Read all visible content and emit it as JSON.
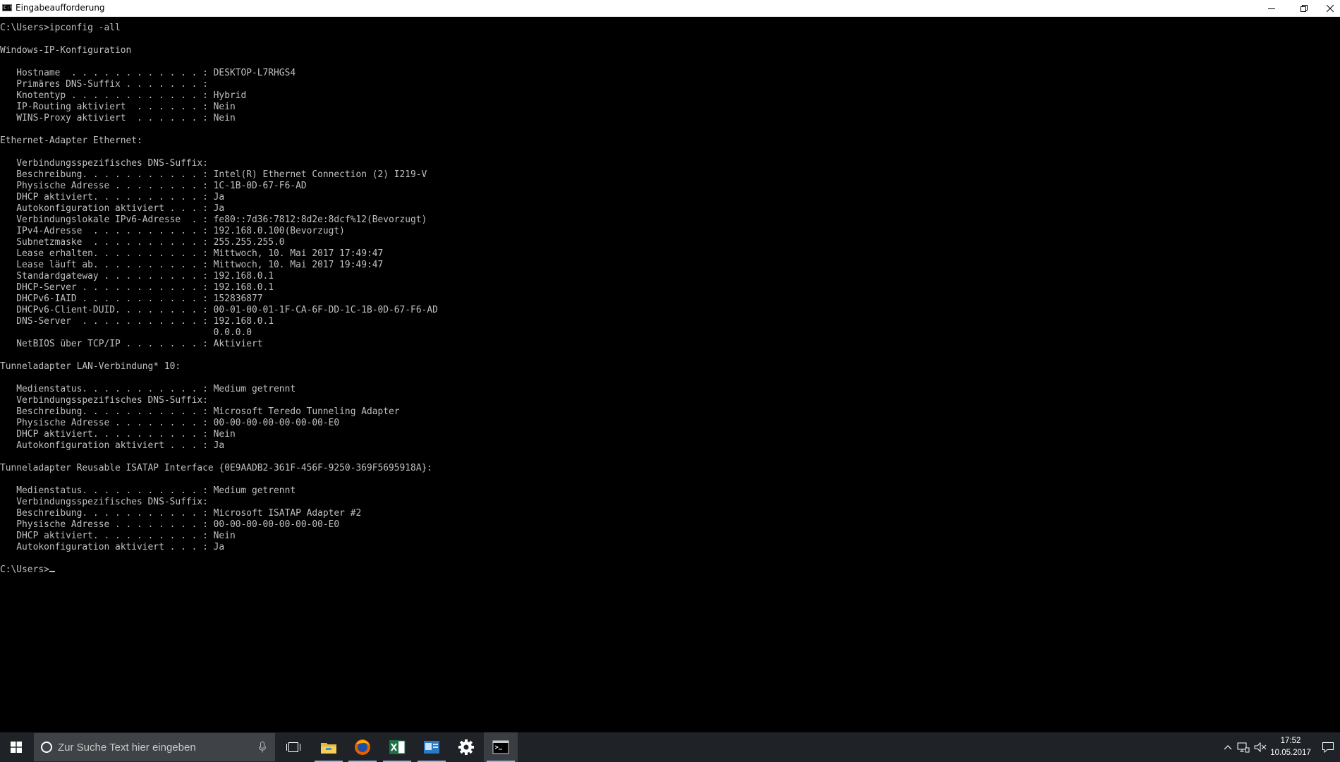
{
  "window": {
    "title": "Eingabeaufforderung",
    "icon_text": "C:\\",
    "controls": [
      "minimize-icon",
      "restore-icon",
      "close-icon"
    ]
  },
  "console": {
    "lines": [
      "C:\\Users>ipconfig -all",
      "",
      "Windows-IP-Konfiguration",
      "",
      "   Hostname  . . . . . . . . . . . . : DESKTOP-L7RHGS4",
      "   Primäres DNS-Suffix . . . . . . . :",
      "   Knotentyp . . . . . . . . . . . . : Hybrid",
      "   IP-Routing aktiviert  . . . . . . : Nein",
      "   WINS-Proxy aktiviert  . . . . . . : Nein",
      "",
      "Ethernet-Adapter Ethernet:",
      "",
      "   Verbindungsspezifisches DNS-Suffix:",
      "   Beschreibung. . . . . . . . . . . : Intel(R) Ethernet Connection (2) I219-V",
      "   Physische Adresse . . . . . . . . : 1C-1B-0D-67-F6-AD",
      "   DHCP aktiviert. . . . . . . . . . : Ja",
      "   Autokonfiguration aktiviert . . . : Ja",
      "   Verbindungslokale IPv6-Adresse  . : fe80::7d36:7812:8d2e:8dcf%12(Bevorzugt)",
      "   IPv4-Adresse  . . . . . . . . . . : 192.168.0.100(Bevorzugt)",
      "   Subnetzmaske  . . . . . . . . . . : 255.255.255.0",
      "   Lease erhalten. . . . . . . . . . : Mittwoch, 10. Mai 2017 17:49:47",
      "   Lease läuft ab. . . . . . . . . . : Mittwoch, 10. Mai 2017 19:49:47",
      "   Standardgateway . . . . . . . . . : 192.168.0.1",
      "   DHCP-Server . . . . . . . . . . . : 192.168.0.1",
      "   DHCPv6-IAID . . . . . . . . . . . : 152836877",
      "   DHCPv6-Client-DUID. . . . . . . . : 00-01-00-01-1F-CA-6F-DD-1C-1B-0D-67-F6-AD",
      "   DNS-Server  . . . . . . . . . . . : 192.168.0.1",
      "                                       0.0.0.0",
      "   NetBIOS über TCP/IP . . . . . . . : Aktiviert",
      "",
      "Tunneladapter LAN-Verbindung* 10:",
      "",
      "   Medienstatus. . . . . . . . . . . : Medium getrennt",
      "   Verbindungsspezifisches DNS-Suffix:",
      "   Beschreibung. . . . . . . . . . . : Microsoft Teredo Tunneling Adapter",
      "   Physische Adresse . . . . . . . . : 00-00-00-00-00-00-00-E0",
      "   DHCP aktiviert. . . . . . . . . . : Nein",
      "   Autokonfiguration aktiviert . . . : Ja",
      "",
      "Tunneladapter Reusable ISATAP Interface {0E9AADB2-361F-456F-9250-369F5695918A}:",
      "",
      "   Medienstatus. . . . . . . . . . . : Medium getrennt",
      "   Verbindungsspezifisches DNS-Suffix:",
      "   Beschreibung. . . . . . . . . . . : Microsoft ISATAP Adapter #2",
      "   Physische Adresse . . . . . . . . : 00-00-00-00-00-00-00-E0",
      "   DHCP aktiviert. . . . . . . . . . : Nein",
      "   Autokonfiguration aktiviert . . . : Ja",
      ""
    ],
    "prompt": "C:\\Users>"
  },
  "taskbar": {
    "search_placeholder": "Zur Suche Text hier eingeben",
    "apps": [
      {
        "name": "file-explorer",
        "icon": "folder-icon"
      },
      {
        "name": "firefox",
        "icon": "firefox-icon"
      },
      {
        "name": "excel",
        "icon": "excel-icon"
      },
      {
        "name": "outlook",
        "icon": "outlook-icon"
      },
      {
        "name": "settings",
        "icon": "gear-icon"
      },
      {
        "name": "command-prompt",
        "icon": "cmd-icon"
      }
    ],
    "clock": {
      "time": "17:52",
      "date": "10.05.2017"
    }
  },
  "colors": {
    "console_bg": "#000000",
    "console_fg": "#c0c0c0",
    "taskbar_bg": "#1f2226",
    "accent": "#8fb8e8"
  }
}
